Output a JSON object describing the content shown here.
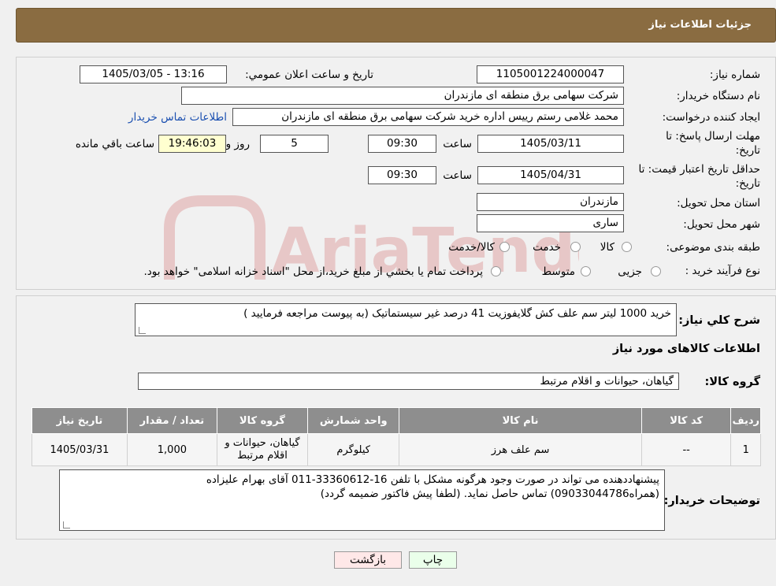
{
  "header": {
    "title": "جزئیات اطلاعات نیاز"
  },
  "watermark": {
    "text": "AriaTender.neT"
  },
  "form": {
    "need_number_label": "شماره نیاز:",
    "need_number": "1105001224000047",
    "announce_label": "تاریخ و ساعت اعلان عمومي:",
    "announce_value": "1405/03/05 - 13:16",
    "buyer_org_label": "نام دستگاه خريدار:",
    "buyer_org": "شرکت سهامی برق منطقه ای مازندران",
    "creator_label": "ايجاد کننده درخواست:",
    "creator": "محمد غلامی رستم رییس اداره خرید شرکت سهامی برق منطقه ای مازندران",
    "contact_link": "اطلاعات تماس خريدار",
    "deadline_label_1": "مهلت ارسال پاسخ: تا",
    "deadline_label_2": "تاريخ:",
    "deadline_date": "1405/03/11",
    "time_label": "ساعت",
    "deadline_time": "09:30",
    "days_value": "5",
    "days_label": "روز و",
    "remaining_time": "19:46:03",
    "remaining_label": "ساعت باقي مانده",
    "validity_label_1": "حداقل تاريخ اعتبار قيمت: تا",
    "validity_label_2": "تاريخ:",
    "validity_date": "1405/04/31",
    "validity_time": "09:30",
    "province_label": "استان محل تحويل:",
    "province": "مازندران",
    "city_label": "شهر محل تحويل:",
    "city": "ساری",
    "category_label": "طبقه بندی موضوعی:",
    "category_options": [
      "کالا",
      "خدمت",
      "کالا/خدمت"
    ],
    "process_label": "نوع فرآيند خريد :",
    "process_options": [
      "جزیی",
      "متوسط"
    ],
    "process_note": "پرداخت تمام يا بخشي از مبلغ خريد،از محل \"اسناد خزانه اسلامی\" خواهد بود."
  },
  "details": {
    "summary_label": "شرح کلي نياز:",
    "summary": "خرید 1000 لیتر سم علف کش گلایفوزیت 41 درصد غیر سیستماتیک (به پیوست مراجعه فرمایید )",
    "goods_info_title": "اطلاعات کالاهای مورد نياز",
    "goods_group_label": "گروه کالا:",
    "goods_group": "گیاهان، حیوانات و اقلام مرتبط"
  },
  "table": {
    "headers": [
      "رديف",
      "کد کالا",
      "نام کالا",
      "واحد شمارش",
      "گروه کالا",
      "تعداد / مقدار",
      "تاريخ نياز"
    ],
    "rows": [
      [
        "1",
        "--",
        "سم علف هرز",
        "کیلوگرم",
        "گیاهان، حیوانات و اقلام مرتبط",
        "1,000",
        "1405/03/31"
      ]
    ]
  },
  "buyer_notes": {
    "label": "توضيحات خريدار:",
    "line1": "پیشنهاددهنده می تواند در صورت وجود هرگونه مشکل با تلفن 16-33360612-011 آقای بهرام علیزاده",
    "line2": "(همراه09033044786) تماس حاصل نماید. (لطفا پیش فاکتور ضمیمه گردد)"
  },
  "buttons": {
    "print": "چاپ",
    "back": "بازگشت"
  },
  "colors": {
    "header": "#8a6c41",
    "link": "#1a4fb0",
    "table_header": "#8e8e8e",
    "back_button": "#ffe8e8",
    "print_button": "#eaffea"
  }
}
